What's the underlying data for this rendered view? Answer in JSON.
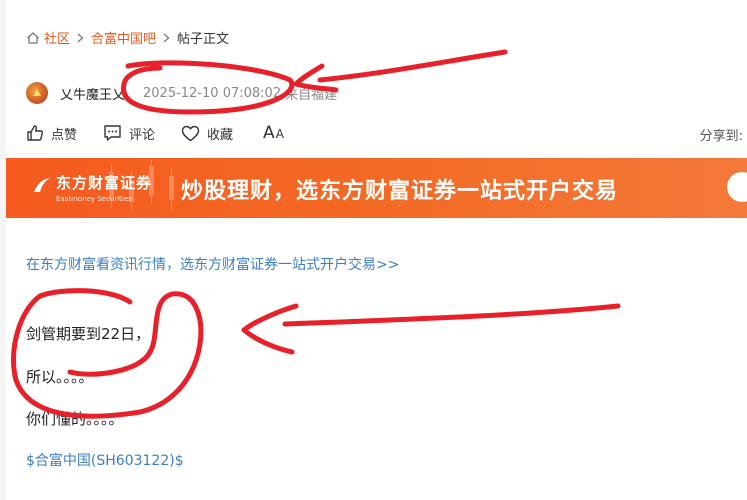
{
  "breadcrumb": {
    "community": "社区",
    "forum": "合富中国吧",
    "current": "帖子正文"
  },
  "post": {
    "author": "乂牛魔王乂",
    "time": "2025-12-10 07:08:02",
    "source": "来自福建"
  },
  "actions": {
    "like": "点赞",
    "comment": "评论",
    "favorite": "收藏",
    "font_big": "A",
    "font_small": "A",
    "share": "分享到:"
  },
  "banner": {
    "logo_cn": "东方财富证券",
    "logo_en": "Eastmoney Securities",
    "slogan": "炒股理财，选东方财富证券一站式开户交易"
  },
  "content": {
    "promo": "在东方财富看资讯行情，选东方财富证券一站式开户交易>>",
    "line1": "剑管期要到22日，",
    "line2": "所以。。。。",
    "line3": "你们懂的。。。。",
    "stock": "$合富中国(SH603122)$"
  },
  "colors": {
    "accent": "#e2591c",
    "link": "#3b7fc4",
    "banner": "#f55a1f",
    "annotation": "#e8202a"
  }
}
